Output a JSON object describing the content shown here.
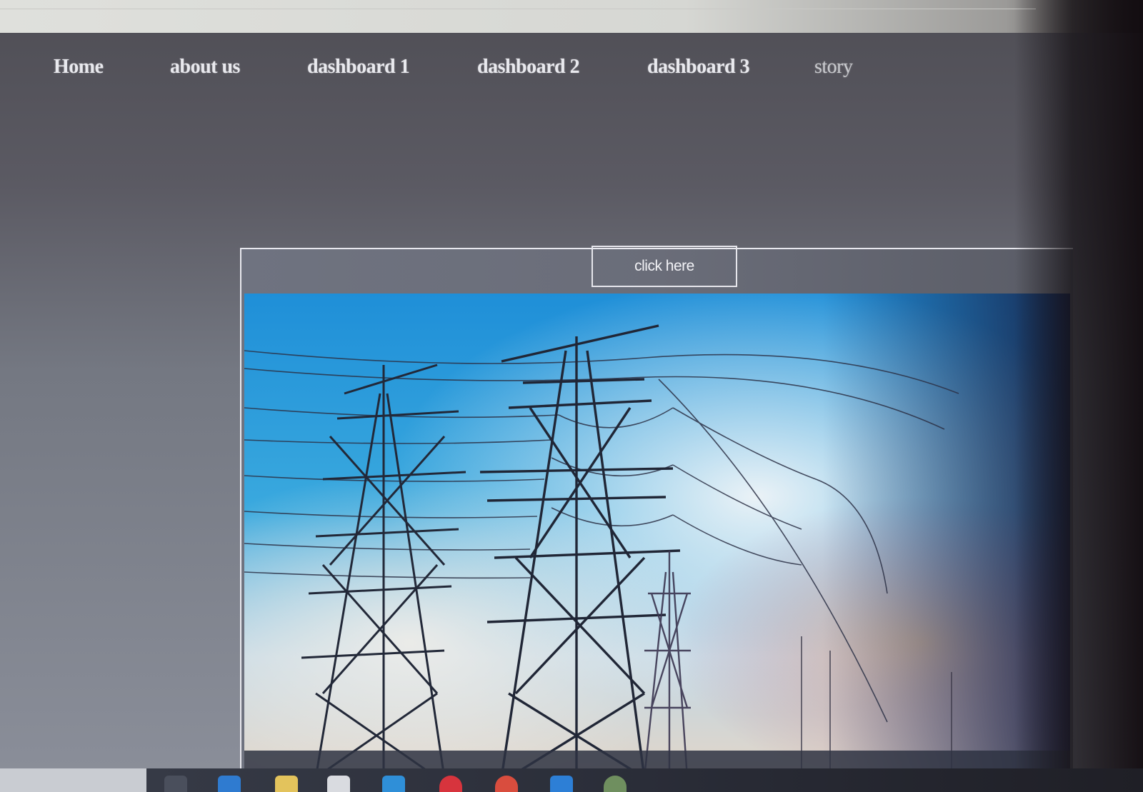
{
  "nav": {
    "items": [
      {
        "label": "Home"
      },
      {
        "label": "about us"
      },
      {
        "label": "dashboard 1"
      },
      {
        "label": "dashboard 2"
      },
      {
        "label": "dashboard 3"
      },
      {
        "label": "story"
      }
    ]
  },
  "main": {
    "button_label": "click here",
    "hero_image": "electricity-transmission-towers-photo"
  },
  "taskbar": {
    "icons": [
      "task-view-icon",
      "edge-icon",
      "file-explorer-icon",
      "store-icon",
      "mail-icon",
      "opera-icon",
      "chrome-icon",
      "vscode-icon",
      "chrome-icon"
    ]
  },
  "colors": {
    "page_background": "#5b5a63",
    "nav_text": "#e9e9ee",
    "panel_border": "#e8e8ee",
    "sky_blue": "#2a9ad6"
  }
}
